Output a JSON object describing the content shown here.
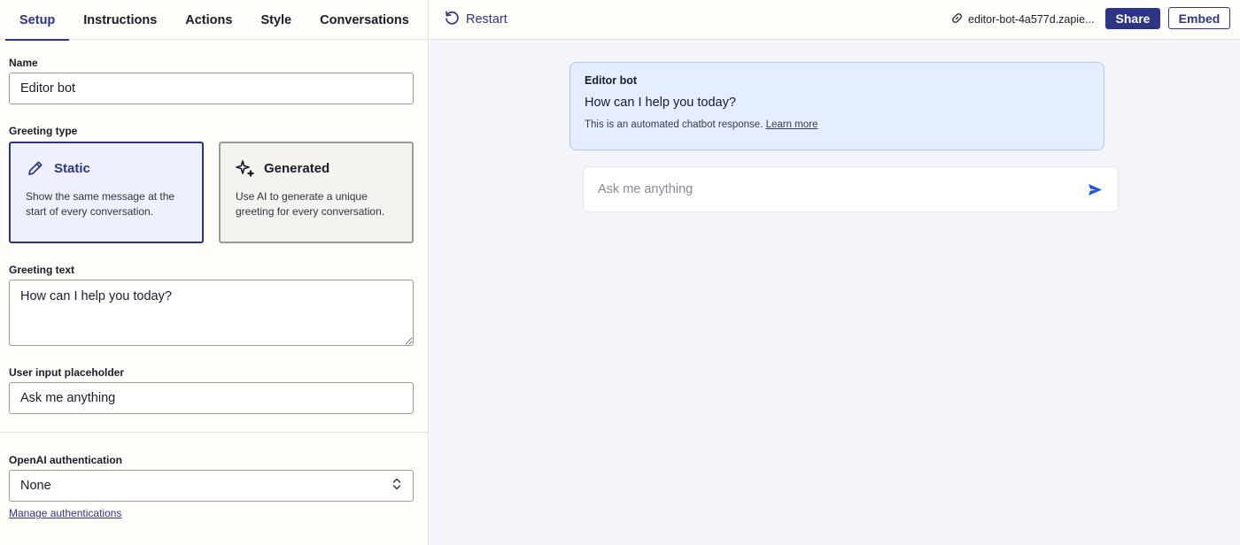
{
  "tabs": [
    {
      "label": "Setup",
      "active": true
    },
    {
      "label": "Instructions",
      "active": false
    },
    {
      "label": "Actions",
      "active": false
    },
    {
      "label": "Style",
      "active": false
    },
    {
      "label": "Conversations",
      "active": false
    }
  ],
  "form": {
    "name_label": "Name",
    "name_value": "Editor bot",
    "greeting_type_label": "Greeting type",
    "greeting_options": [
      {
        "title": "Static",
        "description": "Show the same message at the start of every conversation.",
        "icon": "pencil-icon",
        "selected": true
      },
      {
        "title": "Generated",
        "description": "Use AI to generate a unique greeting for every conversation.",
        "icon": "sparkle-icon",
        "selected": false
      }
    ],
    "greeting_text_label": "Greeting text",
    "greeting_text_value": "How can I help you today?",
    "placeholder_label": "User input placeholder",
    "placeholder_value": "Ask me anything",
    "auth_label": "OpenAI authentication",
    "auth_value": "None",
    "manage_link": "Manage authentications"
  },
  "topbar": {
    "restart_label": "Restart",
    "url_text": "editor-bot-4a577d.zapie...",
    "share_label": "Share",
    "embed_label": "Embed"
  },
  "preview": {
    "bot_name": "Editor bot",
    "greeting": "How can I help you today?",
    "note": "This is an automated chatbot response.",
    "learn_more": "Learn more",
    "input_placeholder": "Ask me anything"
  },
  "colors": {
    "accent": "#2e3584",
    "send": "#1f5ae0",
    "bubble_bg": "#e5eeff",
    "bubble_border": "#aac6f4"
  }
}
